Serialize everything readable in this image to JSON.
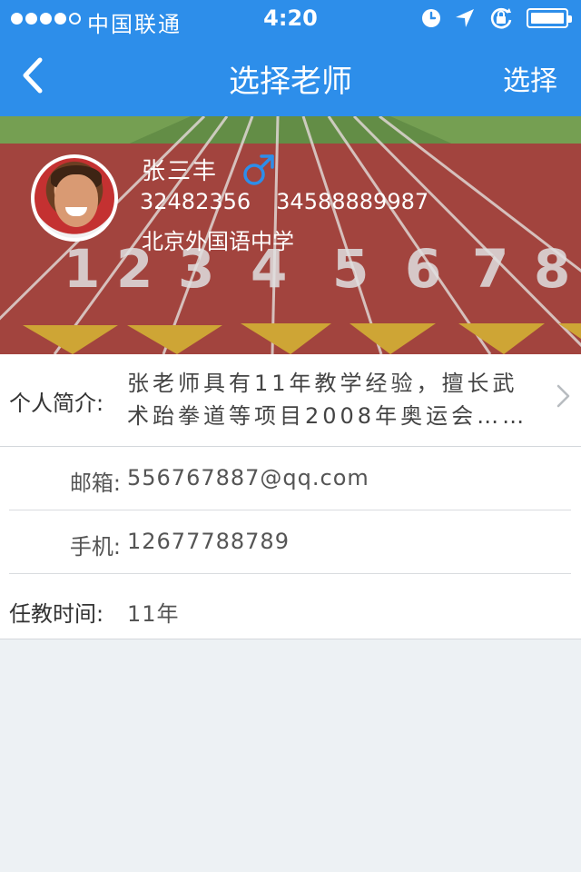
{
  "status_bar": {
    "carrier": "中国联通",
    "time": "4:20"
  },
  "nav": {
    "title": "选择老师",
    "action": "选择"
  },
  "profile": {
    "name": "张三丰",
    "phone_1": "32482356",
    "phone_2": "34588889987",
    "school": "北京外国语中学"
  },
  "intro": {
    "label": "个人简介:",
    "line_1": "张老师具有11年教学经验，擅长武",
    "line_2": "术跆拳道等项目2008年奥运会……"
  },
  "details": {
    "email_label": "邮箱:",
    "email_value": "556767887@qq.com",
    "mobile_label": "手机:",
    "mobile_value": "12677788789",
    "tenure_label": "任教时间:",
    "tenure_value": "11年"
  },
  "colors": {
    "accent": "#2d8eea",
    "background": "#edf1f4",
    "male_icon": "#2d8eea"
  },
  "icons": {
    "back": "chevron-left-icon",
    "gender": "male-icon",
    "disclosure": "chevron-right-icon"
  }
}
